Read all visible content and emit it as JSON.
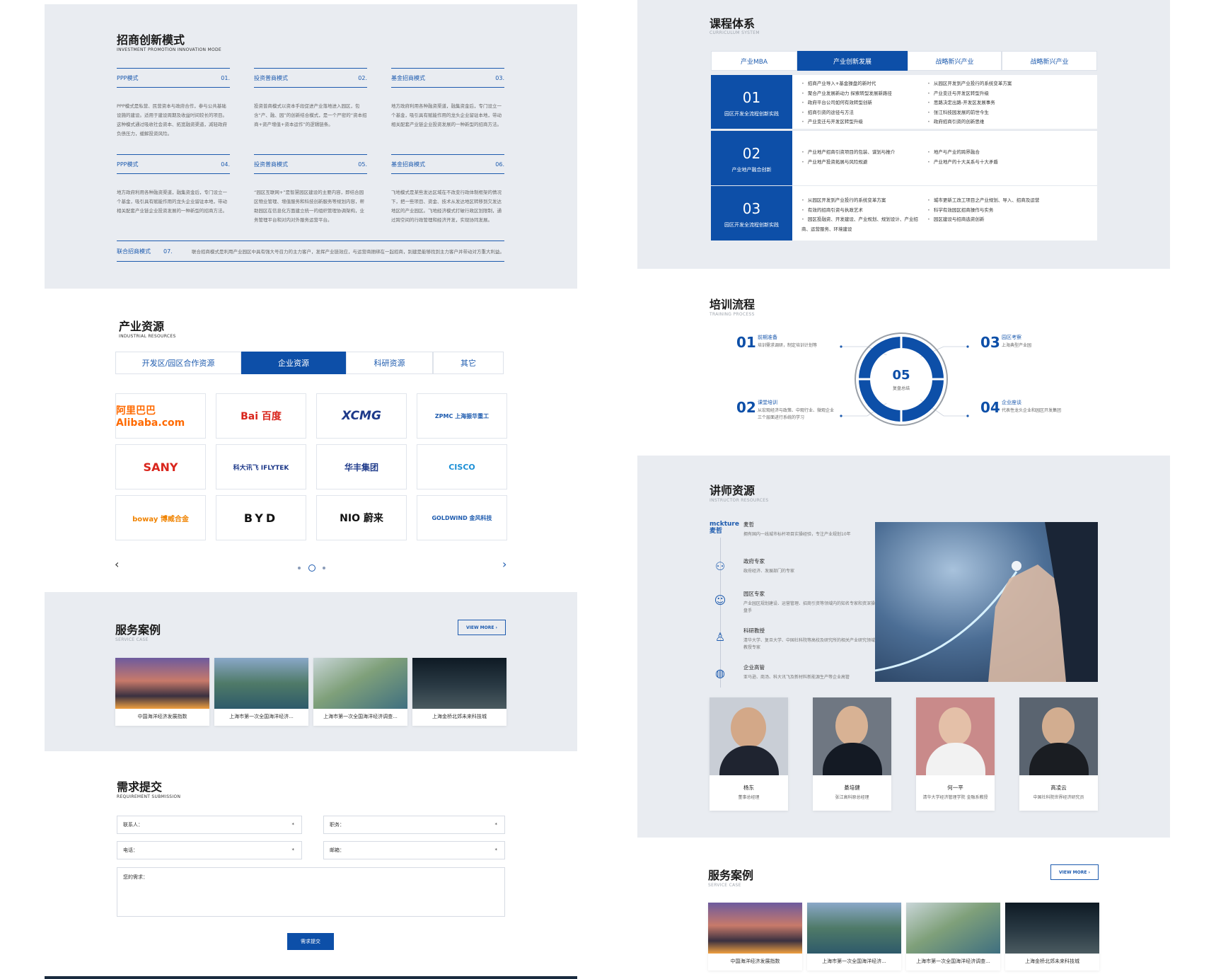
{
  "left": {
    "investment": {
      "title": "招商创新模式",
      "subtitle": "INVESTMENT PROMOTION INNOVATION MODE",
      "modes": [
        {
          "name": "PPP模式",
          "no": "01.",
          "text": "PPP模式是私营、民营资本与政府合作，参与公共基础设施的建设。适用于建设周期及收益时间较长的项目。这种模式通过吸收社会资本、拓宽融资渠道，减轻政府负债压力，缓解投资风险。"
        },
        {
          "name": "投资普商模式",
          "no": "02.",
          "text": "投资普商模式以资本手段促进产业落地进入园区，包含“产、融、园”的创新结合模式，是一个严密的“资本招商+资产增值+资本运作”的逻辑链条。"
        },
        {
          "name": "基金招商模式",
          "no": "03.",
          "text": "地方政府利用各种融资渠道，融集资金后，专门设立一个基金，吸引具有赋能作用的龙头企业留驻本地，带动相关配套产业链企业投资发展的一种新型的招商方法。"
        },
        {
          "name": "PPP模式",
          "no": "04.",
          "text": "地方政府利用各种融资渠道，融集资金后，专门设立一个基金，吸引具有赋能作用的龙头企业留驻本地，带动相关配套产业链企业投资发展的一种新型的招商方法。"
        },
        {
          "name": "投资普商模式",
          "no": "05.",
          "text": "“园区互联网+”是智慧园区建设的主要内容，即结合园区物业管理、增值服务和科技创新服务等规划内容，帮助园区在信息化方面建立统一的组织管理协调架构，业务管理平台和对内对外服务运营平台。"
        },
        {
          "name": "基金招商模式",
          "no": "06.",
          "text": "飞地模式是某些发达区域在不改变行政体制框架的情况下，把一些项目、资金、技术从发达地区转移到欠发达地区的产业园区。飞地经济模式打破行政区划限制，通过跨空间的行政管理和经济开发，实现协同发展。"
        }
      ],
      "joint": {
        "name": "联合招商模式",
        "no": "07.",
        "text": "联合招商模式是利用产业园区中具有强大号召力的主力客户，发挥产业链效应，与运营商捆绑在一起招商，别建是能够找到主力客户并带动对方重大利益。"
      }
    },
    "industrial": {
      "title": "产业资源",
      "subtitle": "INDUSTRIAL RESOURCES",
      "tabs": [
        "开发区/园区合作资源",
        "企业资源",
        "科研资源",
        "其它"
      ],
      "logos": [
        "阿里巴巴 Alibaba.com",
        "Bai 百度",
        "XCMG",
        "ZPMC 上海振华重工",
        "SANY",
        "科大讯飞 IFLYTEK",
        "华丰集团",
        "CISCO",
        "boway 博威合金",
        "BYD",
        "NIO 蔚来",
        "GOLDWIND 金风科技"
      ],
      "prev": "‹",
      "next": "›"
    },
    "cases": {
      "title": "服务案例",
      "subtitle": "SERVICE CASE",
      "more": "VIEW MORE  ›",
      "items": [
        "中国海洋经济发展指数",
        "上海市第一次全国海洋经济...",
        "上海市第一次全国海洋经济调查...",
        "上海金桥北郊未来科技城"
      ]
    },
    "form": {
      "title": "需求提交",
      "subtitle": "REQUIREMENT  SUBMISSION",
      "contact": "联系人：",
      "position": "职务：",
      "phone": "电话：",
      "email": "邮箱：",
      "star": "*",
      "need": "您的需求：",
      "submit": "需求提交"
    }
  },
  "right": {
    "curriculum": {
      "title": "课程体系",
      "subtitle": "CURRICULUM SYSTEM",
      "tabs": [
        "产业MBA",
        "产业创新发展",
        "战略新兴产业",
        "战略新兴产业"
      ],
      "rows": [
        {
          "num": "01",
          "name": "园区开发全流程创新实践",
          "a": [
            "招商产业导入+基金操盘的新时代",
            "聚合产业发展新动力 探索转型发展新路径",
            "政府平台公司如何有效转型创新",
            "招商引资的途径与方法",
            "产业变迁与开发区转型升级"
          ],
          "b": [
            "从园区开发到产业投行的系统变革方案",
            "产业变迁与开发区转型升级",
            "思路决定出路-开发区发展事务",
            "张江科技园发展的前世今生",
            "政府招商引资的创新思维"
          ]
        },
        {
          "num": "02",
          "name": "产业地产融合创新",
          "a": [
            "产业地产招商引资项目的包装、谋划与推介",
            "产业地产投资拓展与风险规避"
          ],
          "b": [
            "地产与产业的跨界融合",
            "产业地产的十大关系与十大矛盾"
          ]
        },
        {
          "num": "03",
          "name": "园区开发全流程创新实践",
          "a": [
            "从园区开发到产业投行的系统变革方案",
            "有效的招商引资与执政艺术",
            "园区投融资、开发建设、产业规划、规划设计、产业招商、运营服务、环境建设"
          ],
          "b": [
            "城市更新工改工项目之产业规划、导入、招商及运营",
            "科学有效园区招商操作与实务",
            "园区建设与招商选资创新"
          ]
        }
      ]
    },
    "training": {
      "title": "培训流程",
      "subtitle": "TRAINING PROCESS",
      "center_num": "05",
      "center_label": "复盘总结",
      "steps": [
        {
          "n": "01",
          "h": "前期准备",
          "d": "培训需求调研，制定培训计划等"
        },
        {
          "n": "02",
          "h": "课堂培训",
          "d": "从宏观经济与政策、中观行业、微观企业三个层面进行系统的学习"
        },
        {
          "n": "03",
          "h": "园区考察",
          "d": "上海典型产业园"
        },
        {
          "n": "04",
          "h": "企业座谈",
          "d": "代表性龙头企业和园区开发集团"
        }
      ]
    },
    "instructors": {
      "title": "讲师资源",
      "subtitle": "INSTRUCTOR RESOURCES",
      "brand": "mckture 麦哲",
      "brand_desc": "拥有国内一线城市标杆项目实操经验，专注产业规划10年",
      "brand_name": "麦哲",
      "items": [
        {
          "h": "政府专家",
          "d": "政府经济、发展部门的专家"
        },
        {
          "h": "园区专家",
          "d": "产业园区规划建设、运营管理、招商引资等领域内的知名专家和资深操盘手"
        },
        {
          "h": "科研教授",
          "d": "清华大学、复旦大学、中国社科院等高校及研究所的相关产业研究领域教授专家"
        },
        {
          "h": "企业高管",
          "d": "亚马逊、商汤、科大讯飞及新材料新能源生产等企业高管"
        }
      ],
      "people": [
        {
          "name": "杨东",
          "title": "董事总经理"
        },
        {
          "name": "綦培健",
          "title": "张江高科原总经理"
        },
        {
          "name": "何一平",
          "title": "清华大学经济管理学院 金融系教授"
        },
        {
          "name": "高凌云",
          "title": "中国社科院世界经济研究员"
        }
      ]
    },
    "cases": {
      "title": "服务案例",
      "subtitle": "SERVICE CASE",
      "more": "VIEW MORE  ›",
      "items": [
        "中国海洋经济发展指数",
        "上海市第一次全国海洋经济...",
        "上海市第一次全国海洋经济调查...",
        "上海金桥北郊未来科技城"
      ]
    }
  }
}
